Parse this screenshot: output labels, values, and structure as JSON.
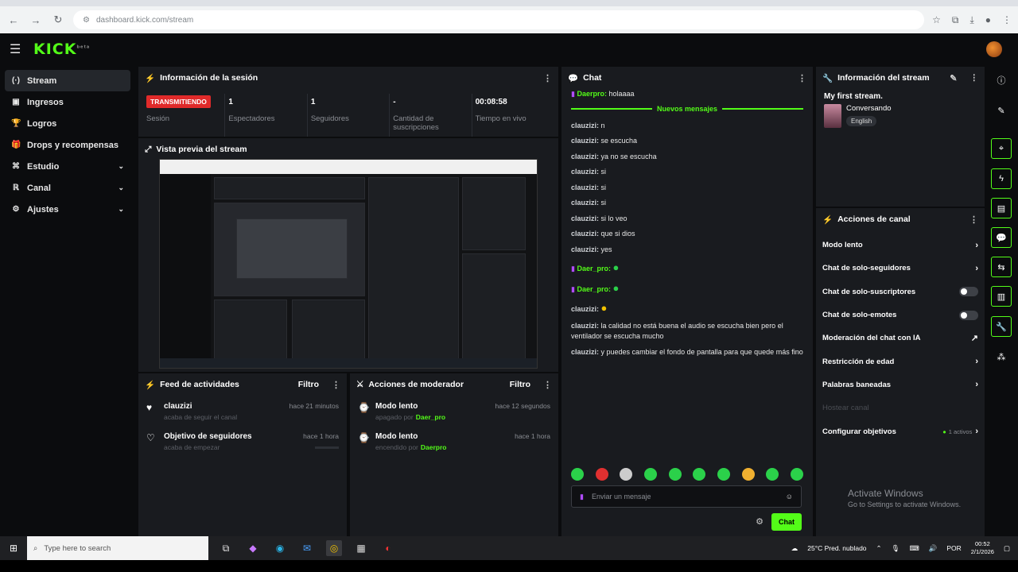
{
  "browser": {
    "url": "dashboard.kick.com/stream"
  },
  "brand": {
    "logo": "KICK",
    "beta": "beta",
    "accent": "#53fc18"
  },
  "sidebar": {
    "items": [
      {
        "label": "Stream",
        "icon": "broadcast-icon",
        "glyph": "(·)",
        "active": true
      },
      {
        "label": "Ingresos",
        "icon": "money-icon",
        "glyph": "▣"
      },
      {
        "label": "Logros",
        "icon": "trophy-icon",
        "glyph": "🏆"
      },
      {
        "label": "Drops y recompensas",
        "icon": "gift-icon",
        "glyph": "🎁"
      },
      {
        "label": "Estudio",
        "icon": "studio-icon",
        "glyph": "⌘",
        "chevron": true
      },
      {
        "label": "Canal",
        "icon": "channel-icon",
        "glyph": "ℝ",
        "chevron": true
      },
      {
        "label": "Ajustes",
        "icon": "gear-icon",
        "glyph": "⚙",
        "chevron": true
      }
    ]
  },
  "session": {
    "title": "Información de la sesión",
    "stats": [
      {
        "value": "TRANSMITIENDO",
        "label": "Sesión",
        "badge": true
      },
      {
        "value": "1",
        "label": "Espectadores"
      },
      {
        "value": "1",
        "label": "Seguidores"
      },
      {
        "value": "-",
        "label": "Cantidad de suscripciones"
      },
      {
        "value": "00:08:58",
        "label": "Tiempo en vivo"
      }
    ]
  },
  "preview": {
    "title": "Vista previa del stream"
  },
  "feed": {
    "title": "Feed de actividades",
    "filter": "Filtro",
    "items": [
      {
        "icon": "heart-icon",
        "glyph": "♥",
        "title": "clauzizi",
        "sub": "acaba de seguir el canal",
        "time": "hace 21 minutos"
      },
      {
        "icon": "heart-outline-icon",
        "glyph": "♡",
        "title": "Objetivo de seguidores",
        "sub": "acaba de empezar",
        "time": "hace 1 hora"
      }
    ]
  },
  "modactions": {
    "title": "Acciones de moderador",
    "filter": "Filtro",
    "items": [
      {
        "title": "Modo lento",
        "state": "apagado por",
        "user": "Daer_pro",
        "time": "hace 12 segundos"
      },
      {
        "title": "Modo lento",
        "state": "encendido por",
        "user": "Daerpro",
        "time": "hace 1 hora"
      }
    ]
  },
  "chat": {
    "title": "Chat",
    "pinned": {
      "user": "Daerpro:",
      "text": "holaaaa"
    },
    "new_messages": "Nuevos mensajes",
    "messages": [
      {
        "user": "clauzizi:",
        "text": "n"
      },
      {
        "user": "clauzizi:",
        "text": "se escucha"
      },
      {
        "user": "clauzizi:",
        "text": "ya no se escucha"
      },
      {
        "user": "clauzizi:",
        "text": "si"
      },
      {
        "user": "clauzizi:",
        "text": "si"
      },
      {
        "user": "clauzizi:",
        "text": "si"
      },
      {
        "user": "clauzizi:",
        "text": "si lo veo"
      },
      {
        "user": "clauzizi:",
        "text": "que si dios"
      },
      {
        "user": "clauzizi:",
        "text": "yes"
      },
      {
        "user": "Daer_pro:",
        "text": "",
        "green": true,
        "emote": true
      },
      {
        "user": "Daer_pro:",
        "text": "",
        "green": true,
        "emote": true
      },
      {
        "user": "clauzizi:",
        "text": "",
        "emote": true
      },
      {
        "user": "clauzizi:",
        "text": "la calidad no está buena el audio se escucha bien pero el ventilador se escucha mucho"
      },
      {
        "user": "clauzizi:",
        "text": "y puedes cambiar el fondo de pantalla para que quede más fino"
      }
    ],
    "input_placeholder": "Enviar un mensaje",
    "send_label": "Chat"
  },
  "streaminfo": {
    "title": "Información del stream",
    "stream_title": "My first stream.",
    "category": "Conversando",
    "tag": "English"
  },
  "channel_actions": {
    "title": "Acciones de canal",
    "items": [
      {
        "label": "Modo lento",
        "kind": "chevron"
      },
      {
        "label": "Chat de solo-seguidores",
        "kind": "chevron"
      },
      {
        "label": "Chat de solo-suscriptores",
        "kind": "toggle"
      },
      {
        "label": "Chat de solo-emotes",
        "kind": "toggle"
      },
      {
        "label": "Moderación del chat con IA",
        "kind": "external"
      },
      {
        "label": "Restricción de edad",
        "kind": "chevron"
      },
      {
        "label": "Palabras baneadas",
        "kind": "chevron"
      },
      {
        "label": "Hostear canal",
        "kind": "disabled"
      },
      {
        "label": "Configurar objetivos",
        "kind": "goals",
        "extra": "1 activos"
      }
    ]
  },
  "windows_watermark": {
    "line1": "Activate Windows",
    "line2": "Go to Settings to activate Windows."
  },
  "taskbar": {
    "search_placeholder": "Type here to search",
    "weather": "25°C  Pred. nublado",
    "lang": "POR",
    "time": "00:52",
    "date": "2/1/2026"
  }
}
